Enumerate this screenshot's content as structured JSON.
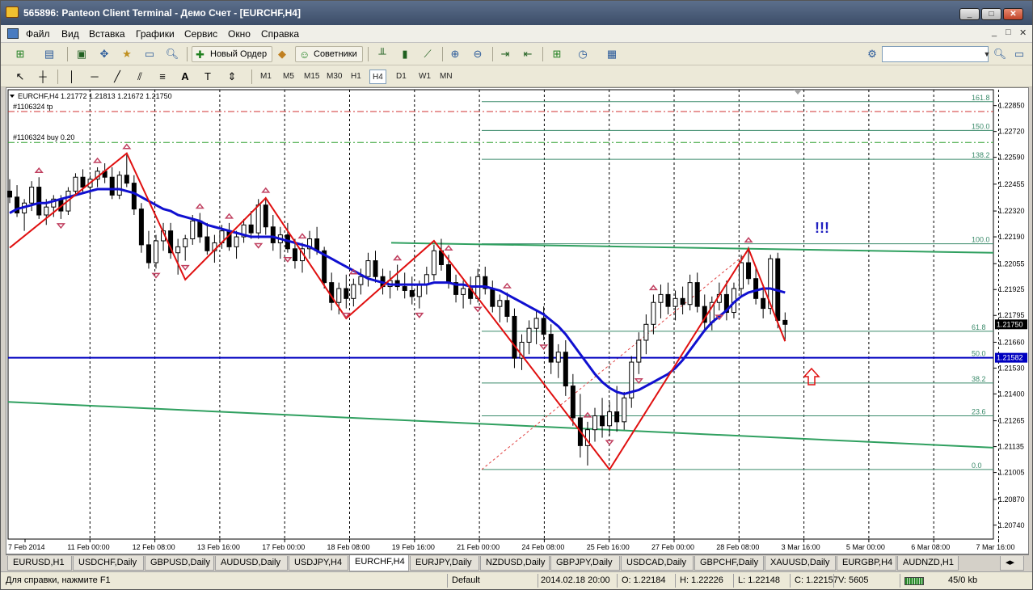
{
  "window": {
    "title": "565896: Panteon Client Terminal - Демо Счет - [EURCHF,H4]",
    "min": "_",
    "max": "□",
    "close": "✕"
  },
  "menu": {
    "items": [
      "Файл",
      "Вид",
      "Вставка",
      "Графики",
      "Сервис",
      "Окно",
      "Справка"
    ],
    "mdi_controls": [
      "_",
      "□",
      "✕"
    ]
  },
  "toolbar": {
    "new_order": "Новый Ордер",
    "experts": "Советники",
    "timeframes": [
      "M1",
      "M5",
      "M15",
      "M30",
      "H1",
      "H4",
      "D1",
      "W1",
      "MN"
    ],
    "active_timeframe": "H4",
    "search_placeholder": ""
  },
  "chart": {
    "header": "EURCHF,H4  1.21772 1.21813 1.21672 1.21750",
    "order_tp_label": "#1106324 tp",
    "order_buy_label": "#1106324 buy 0.20",
    "annotation": "!!!",
    "current_price": "1.21750",
    "level_price": "1.21582",
    "colors": {
      "bull_candle": "#ffffff",
      "bear_candle": "#000000",
      "ma": "#1010d0",
      "zigzag": "#e01010",
      "fib": "#3a8a6a",
      "channel": "#30a060",
      "level": "#0000c0",
      "arrow": "#e01010",
      "markers": "#c04060",
      "grid": "#000000"
    }
  },
  "chart_data": {
    "type": "candlestick",
    "symbol": "EURCHF",
    "timeframe": "H4",
    "y_ticks": [
      "1.22850",
      "1.22720",
      "1.22590",
      "1.22455",
      "1.22320",
      "1.22190",
      "1.22055",
      "1.21925",
      "1.21795",
      "1.21660",
      "1.21530",
      "1.21400",
      "1.21265",
      "1.21135",
      "1.21005",
      "1.20870",
      "1.20740"
    ],
    "ylim": [
      1.2067,
      1.2293
    ],
    "x_ticks": [
      "7 Feb 2014",
      "11 Feb 00:00",
      "12 Feb 08:00",
      "13 Feb 16:00",
      "17 Feb 00:00",
      "18 Feb 08:00",
      "19 Feb 16:00",
      "21 Feb 00:00",
      "24 Feb 08:00",
      "25 Feb 16:00",
      "27 Feb 00:00",
      "28 Feb 08:00",
      "3 Mar 16:00",
      "5 Mar 00:00",
      "6 Mar 08:00",
      "7 Mar 16:00"
    ],
    "fib_levels": [
      {
        "label": "161.8",
        "price": 1.2287
      },
      {
        "label": "150.0",
        "price": 1.22725
      },
      {
        "label": "138.2",
        "price": 1.2258
      },
      {
        "label": "100.0",
        "price": 1.22155
      },
      {
        "label": "61.8",
        "price": 1.21715
      },
      {
        "label": "50.0",
        "price": 1.21582
      },
      {
        "label": "38.2",
        "price": 1.21455
      },
      {
        "label": "23.6",
        "price": 1.2129
      },
      {
        "label": "0.0",
        "price": 1.2102
      }
    ],
    "zigzag": [
      {
        "t": 0,
        "p": 1.22135
      },
      {
        "t": 16,
        "p": 1.2261
      },
      {
        "t": 24,
        "p": 1.21975
      },
      {
        "t": 35,
        "p": 1.22385
      },
      {
        "t": 46,
        "p": 1.2178
      },
      {
        "t": 58,
        "p": 1.2217
      },
      {
        "t": 82,
        "p": 1.2102
      },
      {
        "t": 101,
        "p": 1.2213
      },
      {
        "t": 106,
        "p": 1.21665
      }
    ],
    "candles": [
      [
        1.2242,
        1.2248,
        1.2236,
        1.2239
      ],
      [
        1.2239,
        1.2245,
        1.2229,
        1.2231
      ],
      [
        1.2231,
        1.2238,
        1.2222,
        1.2236
      ],
      [
        1.2236,
        1.2247,
        1.2232,
        1.2244
      ],
      [
        1.2244,
        1.2249,
        1.2228,
        1.223
      ],
      [
        1.223,
        1.2238,
        1.2225,
        1.2234
      ],
      [
        1.2234,
        1.224,
        1.2229,
        1.2238
      ],
      [
        1.2238,
        1.224,
        1.2228,
        1.2232
      ],
      [
        1.2232,
        1.2244,
        1.223,
        1.2242
      ],
      [
        1.2242,
        1.2251,
        1.224,
        1.2249
      ],
      [
        1.2249,
        1.2253,
        1.2241,
        1.2244
      ],
      [
        1.2244,
        1.225,
        1.2238,
        1.2248
      ],
      [
        1.2248,
        1.2254,
        1.2244,
        1.2252
      ],
      [
        1.2252,
        1.2256,
        1.2246,
        1.2249
      ],
      [
        1.2249,
        1.2254,
        1.2238,
        1.224
      ],
      [
        1.224,
        1.2252,
        1.2238,
        1.225
      ],
      [
        1.225,
        1.2261,
        1.2244,
        1.2246
      ],
      [
        1.2246,
        1.225,
        1.223,
        1.2233
      ],
      [
        1.2233,
        1.2236,
        1.2211,
        1.2215
      ],
      [
        1.2215,
        1.2222,
        1.2203,
        1.2206
      ],
      [
        1.2206,
        1.222,
        1.2203,
        1.2217
      ],
      [
        1.2217,
        1.2226,
        1.2212,
        1.2222
      ],
      [
        1.2222,
        1.2226,
        1.2208,
        1.2211
      ],
      [
        1.2211,
        1.2218,
        1.22,
        1.2214
      ],
      [
        1.2214,
        1.222,
        1.2207,
        1.2218
      ],
      [
        1.2218,
        1.223,
        1.2215,
        1.2227
      ],
      [
        1.2227,
        1.2231,
        1.2216,
        1.2219
      ],
      [
        1.2219,
        1.2226,
        1.221,
        1.2212
      ],
      [
        1.2212,
        1.222,
        1.2206,
        1.2216
      ],
      [
        1.2216,
        1.2225,
        1.2213,
        1.2222
      ],
      [
        1.2222,
        1.2226,
        1.2212,
        1.2214
      ],
      [
        1.2214,
        1.2222,
        1.2208,
        1.2219
      ],
      [
        1.2219,
        1.2228,
        1.2216,
        1.2225
      ],
      [
        1.2225,
        1.2232,
        1.2218,
        1.2221
      ],
      [
        1.2221,
        1.2238,
        1.2218,
        1.2235
      ],
      [
        1.2235,
        1.2239,
        1.222,
        1.2224
      ],
      [
        1.2224,
        1.223,
        1.2212,
        1.2216
      ],
      [
        1.2216,
        1.2224,
        1.2208,
        1.222
      ],
      [
        1.222,
        1.2226,
        1.2211,
        1.2213
      ],
      [
        1.2213,
        1.2218,
        1.2203,
        1.2207
      ],
      [
        1.2207,
        1.2216,
        1.2201,
        1.2213
      ],
      [
        1.2213,
        1.2222,
        1.2208,
        1.2218
      ],
      [
        1.2218,
        1.2224,
        1.221,
        1.2212
      ],
      [
        1.2212,
        1.2214,
        1.2193,
        1.2196
      ],
      [
        1.2196,
        1.2201,
        1.2182,
        1.2186
      ],
      [
        1.2186,
        1.2196,
        1.218,
        1.2193
      ],
      [
        1.2193,
        1.22,
        1.2183,
        1.2188
      ],
      [
        1.2188,
        1.2198,
        1.2184,
        1.2195
      ],
      [
        1.2195,
        1.2203,
        1.219,
        1.2199
      ],
      [
        1.2199,
        1.2211,
        1.2194,
        1.2207
      ],
      [
        1.2207,
        1.2212,
        1.2196,
        1.2199
      ],
      [
        1.2199,
        1.2203,
        1.219,
        1.2194
      ],
      [
        1.2194,
        1.2202,
        1.2188,
        1.2197
      ],
      [
        1.2197,
        1.2205,
        1.2192,
        1.2194
      ],
      [
        1.2194,
        1.2201,
        1.2188,
        1.2192
      ],
      [
        1.2192,
        1.2199,
        1.2185,
        1.2189
      ],
      [
        1.2189,
        1.2197,
        1.2183,
        1.2195
      ],
      [
        1.2195,
        1.2204,
        1.219,
        1.22
      ],
      [
        1.22,
        1.2215,
        1.2197,
        1.2212
      ],
      [
        1.2212,
        1.2218,
        1.2202,
        1.2205
      ],
      [
        1.2205,
        1.221,
        1.2193,
        1.2196
      ],
      [
        1.2196,
        1.22,
        1.2186,
        1.219
      ],
      [
        1.219,
        1.2197,
        1.2183,
        1.2193
      ],
      [
        1.2193,
        1.2199,
        1.2185,
        1.2188
      ],
      [
        1.2188,
        1.2203,
        1.2186,
        1.2199
      ],
      [
        1.2199,
        1.2204,
        1.219,
        1.2193
      ],
      [
        1.2193,
        1.2197,
        1.2181,
        1.2184
      ],
      [
        1.2184,
        1.219,
        1.2176,
        1.2187
      ],
      [
        1.2187,
        1.2191,
        1.2176,
        1.2179
      ],
      [
        1.2179,
        1.2183,
        1.2153,
        1.2158
      ],
      [
        1.2158,
        1.217,
        1.2152,
        1.2166
      ],
      [
        1.2166,
        1.2177,
        1.216,
        1.2173
      ],
      [
        1.2173,
        1.2182,
        1.2165,
        1.2178
      ],
      [
        1.2178,
        1.2184,
        1.2167,
        1.217
      ],
      [
        1.217,
        1.2175,
        1.215,
        1.2156
      ],
      [
        1.2156,
        1.2165,
        1.2148,
        1.2161
      ],
      [
        1.2161,
        1.2167,
        1.2139,
        1.2144
      ],
      [
        1.2144,
        1.215,
        1.2124,
        1.2128
      ],
      [
        1.2128,
        1.214,
        1.2108,
        1.2114
      ],
      [
        1.2114,
        1.2126,
        1.2104,
        1.2122
      ],
      [
        1.2122,
        1.2133,
        1.2116,
        1.2129
      ],
      [
        1.2129,
        1.2138,
        1.2118,
        1.2124
      ],
      [
        1.2124,
        1.2136,
        1.2119,
        1.2131
      ],
      [
        1.2131,
        1.2144,
        1.2121,
        1.2126
      ],
      [
        1.2126,
        1.2141,
        1.2122,
        1.2138
      ],
      [
        1.2138,
        1.2159,
        1.2133,
        1.2156
      ],
      [
        1.2156,
        1.2171,
        1.215,
        1.2167
      ],
      [
        1.2167,
        1.218,
        1.216,
        1.2175
      ],
      [
        1.2175,
        1.219,
        1.217,
        1.2186
      ],
      [
        1.2186,
        1.2195,
        1.2178,
        1.219
      ],
      [
        1.219,
        1.2196,
        1.218,
        1.2184
      ],
      [
        1.2184,
        1.2192,
        1.2177,
        1.2188
      ],
      [
        1.2188,
        1.2194,
        1.218,
        1.2185
      ],
      [
        1.2185,
        1.22,
        1.2182,
        1.2196
      ],
      [
        1.2196,
        1.2201,
        1.2181,
        1.2184
      ],
      [
        1.2184,
        1.219,
        1.2171,
        1.2176
      ],
      [
        1.2176,
        1.2189,
        1.2172,
        1.2186
      ],
      [
        1.2186,
        1.2196,
        1.2182,
        1.219
      ],
      [
        1.219,
        1.2197,
        1.2177,
        1.2181
      ],
      [
        1.2181,
        1.2196,
        1.2178,
        1.2193
      ],
      [
        1.2193,
        1.221,
        1.2189,
        1.2206
      ],
      [
        1.2206,
        1.2214,
        1.2195,
        1.2198
      ],
      [
        1.2198,
        1.2204,
        1.2185,
        1.2188
      ],
      [
        1.2188,
        1.2195,
        1.2178,
        1.2183
      ],
      [
        1.2183,
        1.221,
        1.218,
        1.2208
      ],
      [
        1.2208,
        1.2211,
        1.2173,
        1.2177
      ],
      [
        1.2177,
        1.2181,
        1.2167,
        1.2175
      ]
    ],
    "ma": [
      1.2231,
      1.2233,
      1.2234,
      1.2235,
      1.2236,
      1.2236,
      1.2237,
      1.2238,
      1.2239,
      1.224,
      1.2241,
      1.2242,
      1.2243,
      1.2243,
      1.2243,
      1.2243,
      1.2242,
      1.2241,
      1.2239,
      1.2237,
      1.2235,
      1.2233,
      1.2232,
      1.223,
      1.2229,
      1.2228,
      1.2227,
      1.2225,
      1.2224,
      1.2223,
      1.2222,
      1.2221,
      1.222,
      1.2219,
      1.2219,
      1.2219,
      1.2219,
      1.2218,
      1.2217,
      1.2216,
      1.2215,
      1.2214,
      1.2212,
      1.221,
      1.2208,
      1.2206,
      1.2204,
      1.2202,
      1.22,
      1.2198,
      1.2197,
      1.2196,
      1.2195,
      1.2195,
      1.2195,
      1.2195,
      1.2195,
      1.2195,
      1.2196,
      1.2196,
      1.2196,
      1.2195,
      1.2195,
      1.2194,
      1.2194,
      1.2194,
      1.2193,
      1.2192,
      1.219,
      1.2188,
      1.2186,
      1.2184,
      1.2182,
      1.218,
      1.2177,
      1.2174,
      1.217,
      1.2165,
      1.216,
      1.2155,
      1.215,
      1.2146,
      1.2143,
      1.2141,
      1.214,
      1.2141,
      1.2142,
      1.2144,
      1.2146,
      1.2148,
      1.215,
      1.2153,
      1.2157,
      1.2162,
      1.2167,
      1.2172,
      1.2176,
      1.2179,
      1.2182,
      1.2186,
      1.2189,
      1.2191,
      1.2192,
      1.2193,
      1.2193,
      1.2192,
      1.2191
    ]
  },
  "tabs": [
    "EURUSD,H1",
    "USDCHF,Daily",
    "GBPUSD,Daily",
    "AUDUSD,Daily",
    "USDJPY,H4",
    "EURCHF,H4",
    "EURJPY,Daily",
    "NZDUSD,Daily",
    "GBPJPY,Daily",
    "USDCAD,Daily",
    "GBPCHF,Daily",
    "XAUUSD,Daily",
    "EURGBP,H4",
    "AUDNZD,H1"
  ],
  "active_tab": "EURCHF,H4",
  "status": {
    "help": "Для справки, нажмите F1",
    "profile": "Default",
    "datetime": "2014.02.18 20:00",
    "open": "O: 1.22184",
    "high": "H: 1.22226",
    "low": "L: 1.22148",
    "close": "C: 1.22157",
    "volume": "V: 5605",
    "traffic": "45/0 kb"
  }
}
